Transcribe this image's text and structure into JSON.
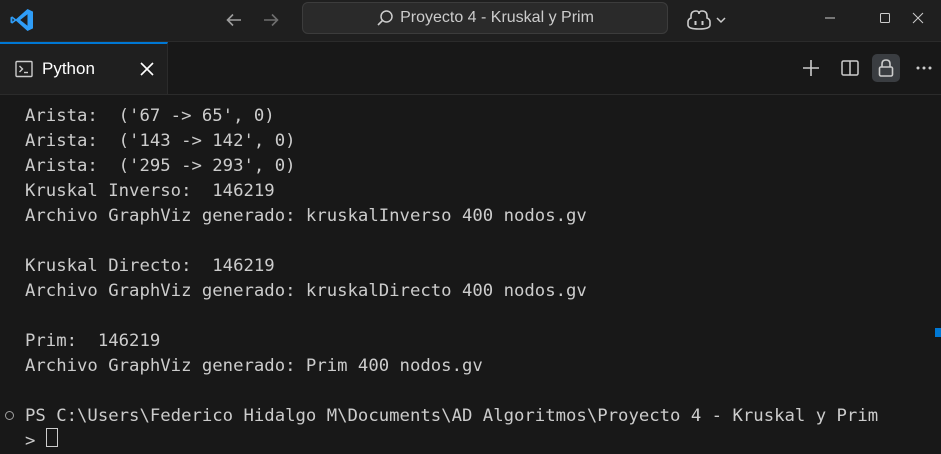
{
  "titlebar": {
    "search_text": "Proyecto 4 - Kruskal y Prim",
    "icons": [
      "vscode-logo-icon",
      "back-arrow-icon",
      "forward-arrow-icon",
      "search-icon",
      "copilot-icon",
      "chevron-down-icon",
      "minimize-icon",
      "maximize-icon",
      "close-window-icon"
    ]
  },
  "panel": {
    "tab_label": "Python",
    "accent": "#0078d4",
    "toolbar_icons": [
      "plus-icon",
      "split-icon",
      "lock-icon",
      "more-icon"
    ]
  },
  "terminal": {
    "lines": [
      "Arista:  ('67 -> 65', 0)",
      "Arista:  ('143 -> 142', 0)",
      "Arista:  ('295 -> 293', 0)",
      "Kruskal Inverso:  146219",
      "Archivo GraphViz generado: kruskalInverso 400 nodos.gv",
      "",
      "Kruskal Directo:  146219",
      "Archivo GraphViz generado: kruskalDirecto 400 nodos.gv",
      "",
      "Prim:  146219",
      "Archivo GraphViz generado: Prim 400 nodos.gv",
      ""
    ],
    "prompt": "PS C:\\Users\\Federico Hidalgo M\\Documents\\AD Algoritmos\\Proyecto 4 - Kruskal y Prim",
    "prompt_continuation": ">"
  }
}
